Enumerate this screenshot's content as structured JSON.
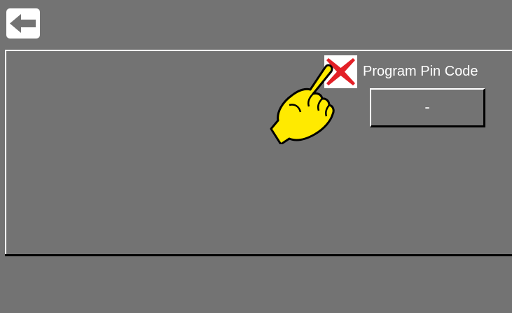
{
  "header": {
    "back_icon": "arrow-left-icon"
  },
  "settings": {
    "pin_checkbox_icon": "red-x-icon",
    "pin_checkbox_checked": false,
    "pin_label": "Program Pin Code",
    "pin_value": "-"
  },
  "overlay": {
    "pointer_icon": "pointing-hand-icon"
  },
  "colors": {
    "background": "#737373",
    "back_button": "#ffffff",
    "x_mark": "#e32027",
    "hand": "#ffea00"
  }
}
